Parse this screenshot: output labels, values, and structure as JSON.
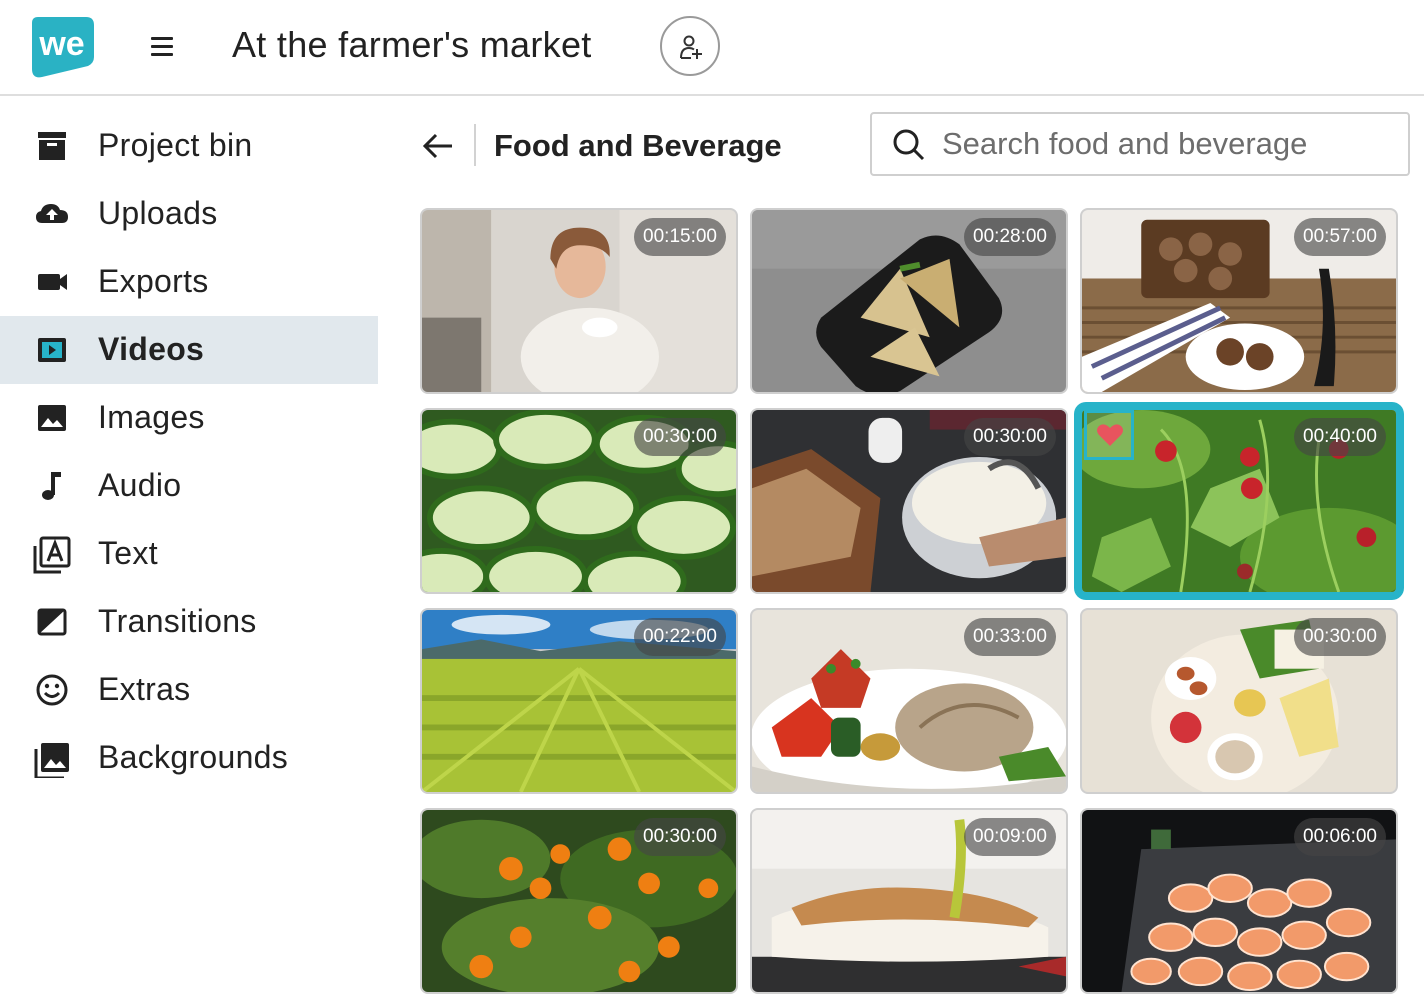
{
  "header": {
    "logo_text": "we",
    "project_title": "At the farmer's market",
    "invite_icon": "add-person-icon",
    "menu_icon": "hamburger-menu-icon"
  },
  "sidebar": {
    "items": [
      {
        "label": "Project bin",
        "icon": "archive-icon"
      },
      {
        "label": "Uploads",
        "icon": "cloud-upload-icon"
      },
      {
        "label": "Exports",
        "icon": "video-camera-icon"
      },
      {
        "label": "Videos",
        "icon": "play-video-icon",
        "active": true
      },
      {
        "label": "Images",
        "icon": "image-icon"
      },
      {
        "label": "Audio",
        "icon": "music-note-icon"
      },
      {
        "label": "Text",
        "icon": "text-icon"
      },
      {
        "label": "Transitions",
        "icon": "transition-icon"
      },
      {
        "label": "Extras",
        "icon": "smiley-icon"
      },
      {
        "label": "Backgrounds",
        "icon": "backgrounds-icon"
      }
    ]
  },
  "content": {
    "category_title": "Food and Beverage",
    "search_placeholder": "Search food and beverage",
    "search_value": "",
    "accent_color": "#27b3c9",
    "videos": [
      {
        "duration": "00:15:00",
        "scene": "woman eating"
      },
      {
        "duration": "00:28:00",
        "scene": "grilled sandwiches"
      },
      {
        "duration": "00:57:00",
        "scene": "walnuts"
      },
      {
        "duration": "00:30:00",
        "scene": "cucumber slices"
      },
      {
        "duration": "00:30:00",
        "scene": "cottage cheese and bread"
      },
      {
        "duration": "00:40:00",
        "scene": "wild strawberries",
        "selected": true,
        "favorite": true
      },
      {
        "duration": "00:22:00",
        "scene": "green field"
      },
      {
        "duration": "00:33:00",
        "scene": "fish with vegetables"
      },
      {
        "duration": "00:30:00",
        "scene": "eggs and cheese"
      },
      {
        "duration": "00:30:00",
        "scene": "orange tree"
      },
      {
        "duration": "00:09:00",
        "scene": "sushi"
      },
      {
        "duration": "00:06:00",
        "scene": "shrimp"
      }
    ]
  }
}
